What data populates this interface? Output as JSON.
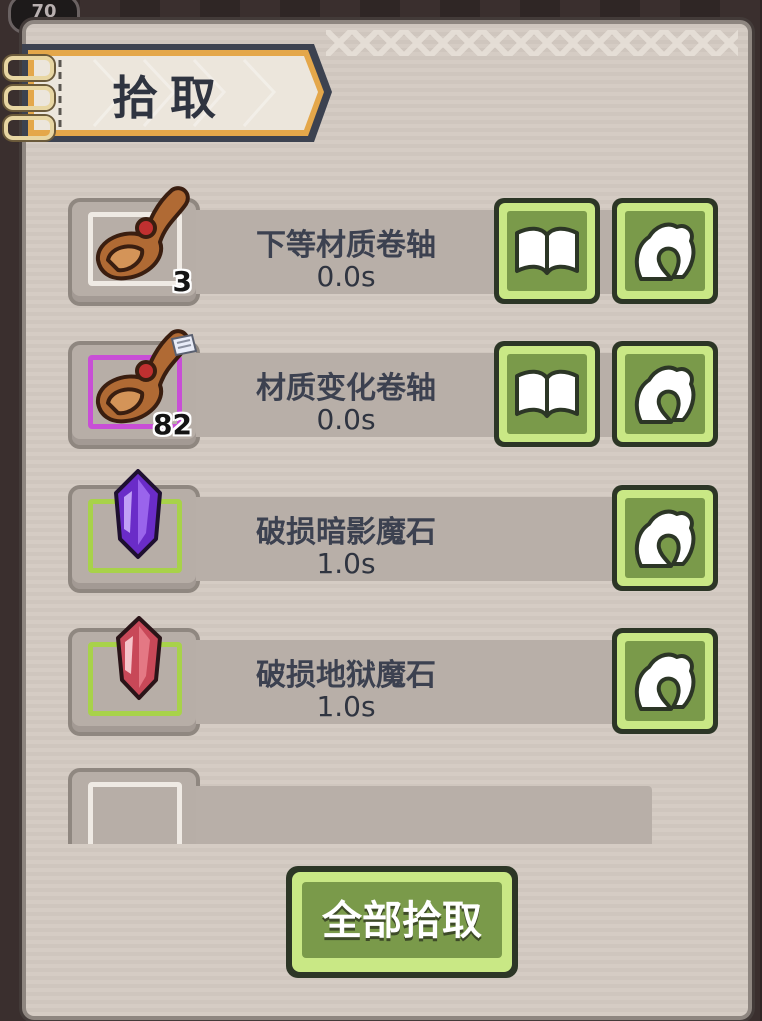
{
  "corner_badge": "70",
  "title": "拾取",
  "items": [
    {
      "name": "下等材质卷轴",
      "time": "0.0s",
      "count": "3",
      "icon": "scroll-icon",
      "frame": "white",
      "has_read": true
    },
    {
      "name": "材质变化卷轴",
      "time": "0.0s",
      "count": "82",
      "icon": "scroll-icon",
      "frame": "purple",
      "has_read": true
    },
    {
      "name": "破损暗影魔石",
      "time": "1.0s",
      "count": "",
      "icon": "purple-crystal-icon",
      "frame": "green",
      "has_read": false
    },
    {
      "name": "破损地狱魔石",
      "time": "1.0s",
      "count": "",
      "icon": "red-crystal-icon",
      "frame": "green",
      "has_read": false
    }
  ],
  "pick_all_label": "全部拾取",
  "colors": {
    "panel": "#d5ccc4",
    "button_green": "#7a9a4a",
    "button_light": "#c9e885",
    "frame_purple": "#c84fd6",
    "frame_green": "#a8d24a"
  }
}
